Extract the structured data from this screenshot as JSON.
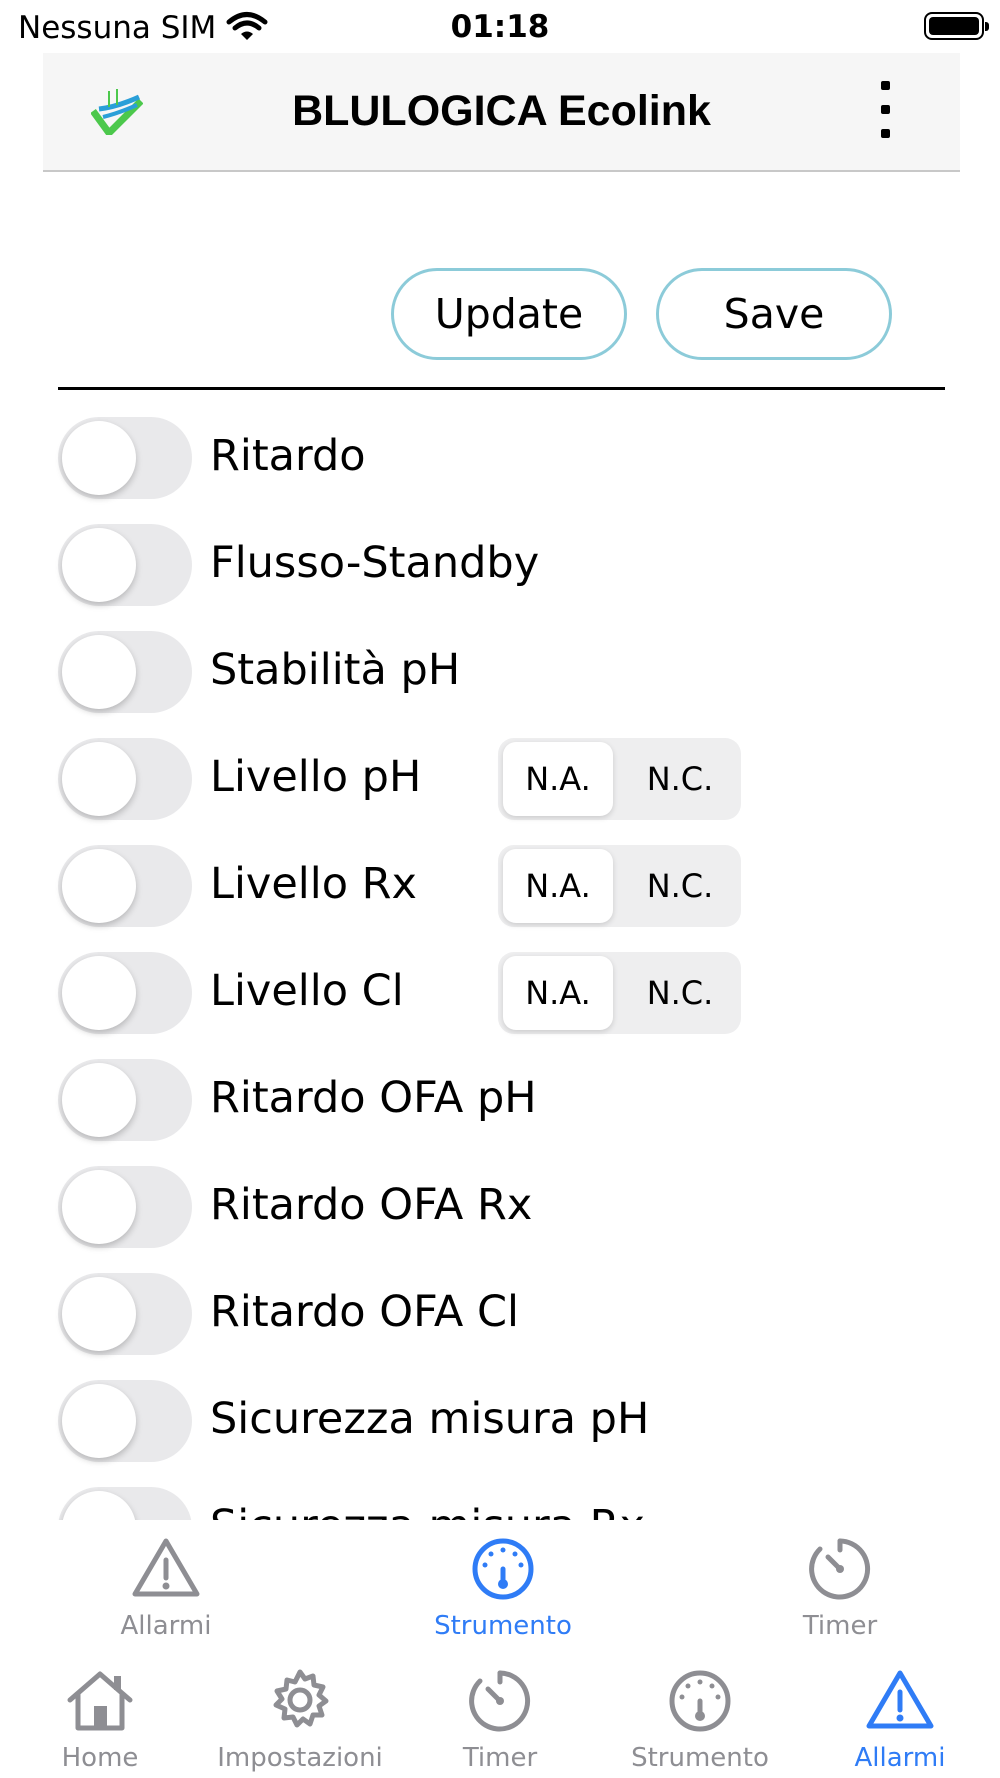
{
  "status_bar": {
    "carrier": "Nessuna SIM",
    "time": "01:18"
  },
  "header": {
    "title": "BLULOGICA Ecolink"
  },
  "actions": {
    "update_label": "Update",
    "save_label": "Save"
  },
  "alarms": [
    {
      "label": "Ritardo",
      "enabled": false
    },
    {
      "label": "Flusso-Standby",
      "enabled": false
    },
    {
      "label": "Stabilità pH",
      "enabled": false
    },
    {
      "label": "Livello pH",
      "enabled": false,
      "options": [
        "N.A.",
        "N.C."
      ],
      "selected": "N.A."
    },
    {
      "label": "Livello Rx",
      "enabled": false,
      "options": [
        "N.A.",
        "N.C."
      ],
      "selected": "N.A."
    },
    {
      "label": "Livello Cl",
      "enabled": false,
      "options": [
        "N.A.",
        "N.C."
      ],
      "selected": "N.A."
    },
    {
      "label": "Ritardo OFA pH",
      "enabled": false
    },
    {
      "label": "Ritardo OFA Rx",
      "enabled": false
    },
    {
      "label": "Ritardo OFA Cl",
      "enabled": false
    },
    {
      "label": "Sicurezza misura pH",
      "enabled": false
    },
    {
      "label": "Sicurezza misura Rx",
      "enabled": false
    }
  ],
  "top_tabs": [
    {
      "label": "Allarmi",
      "icon": "warning-icon",
      "active": false
    },
    {
      "label": "Strumento",
      "icon": "gauge-icon",
      "active": true
    },
    {
      "label": "Timer",
      "icon": "timer-icon",
      "active": false
    }
  ],
  "bottom_tabs": [
    {
      "label": "Home",
      "icon": "home-icon",
      "active": false
    },
    {
      "label": "Impostazioni",
      "icon": "gear-icon",
      "active": false
    },
    {
      "label": "Timer",
      "icon": "timer-icon",
      "active": false
    },
    {
      "label": "Strumento",
      "icon": "gauge-icon",
      "active": false
    },
    {
      "label": "Allarmi",
      "icon": "warning-icon",
      "active": true
    }
  ],
  "colors": {
    "accent": "#2f7cf6",
    "inactive": "#8e8e93",
    "button_border": "#8ccbd9",
    "logo_green": "#4cc84c",
    "logo_blue": "#2a9fd8"
  }
}
